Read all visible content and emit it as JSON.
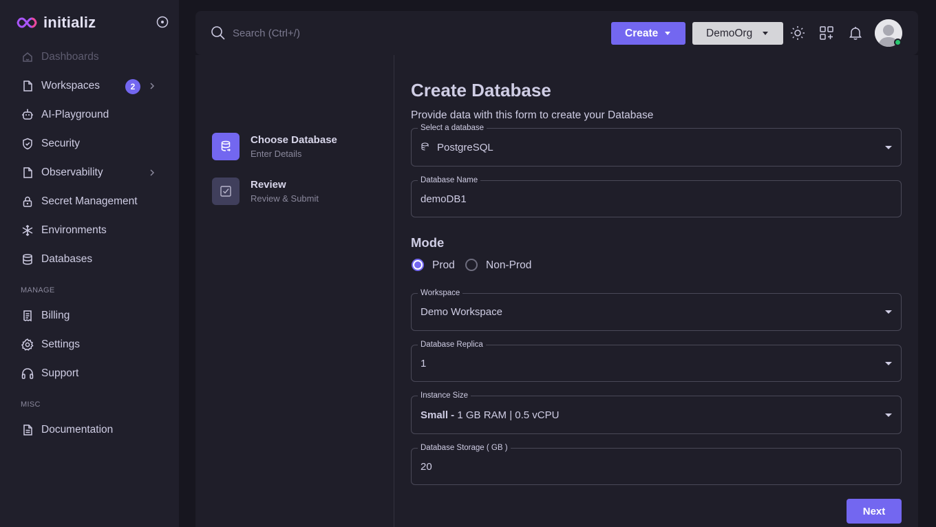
{
  "app": {
    "name": "initializ"
  },
  "sidebar": {
    "items": [
      {
        "label": "Dashboards",
        "icon": "home-icon",
        "disabled": true
      },
      {
        "label": "Workspaces",
        "icon": "file-icon",
        "badge": "2"
      },
      {
        "label": "AI-Playground",
        "icon": "robot-icon"
      },
      {
        "label": "Security",
        "icon": "shield-check-icon"
      },
      {
        "label": "Observability",
        "icon": "file-icon"
      },
      {
        "label": "Secret Management",
        "icon": "lock-icon"
      },
      {
        "label": "Environments",
        "icon": "snowflake-icon"
      },
      {
        "label": "Databases",
        "icon": "database-icon"
      }
    ],
    "manage_title": "MANAGE",
    "manage_items": [
      {
        "label": "Billing",
        "icon": "receipt-icon"
      },
      {
        "label": "Settings",
        "icon": "gear-icon"
      },
      {
        "label": "Support",
        "icon": "headphones-icon"
      }
    ],
    "misc_title": "MISC",
    "misc_items": [
      {
        "label": "Documentation",
        "icon": "document-icon"
      }
    ]
  },
  "topbar": {
    "search_placeholder": "Search (Ctrl+/)",
    "create_label": "Create",
    "org_label": "DemoOrg"
  },
  "steps": [
    {
      "title": "Choose Database",
      "subtitle": "Enter Details",
      "active": true
    },
    {
      "title": "Review",
      "subtitle": "Review & Submit",
      "active": false
    }
  ],
  "form": {
    "title": "Create Database",
    "subtitle": "Provide data with this form to create your Database",
    "database": {
      "label": "Select a database",
      "value": "PostgreSQL"
    },
    "db_name": {
      "label": "Database Name",
      "value": "demoDB1"
    },
    "mode": {
      "title": "Mode",
      "options": [
        "Prod",
        "Non-Prod"
      ],
      "selected": "Prod"
    },
    "workspace": {
      "label": "Workspace",
      "value": "Demo Workspace"
    },
    "replica": {
      "label": "Database Replica",
      "value": "1"
    },
    "instance_size": {
      "label": "Instance Size",
      "value_bold": "Small -",
      "value_rest": "1 GB RAM | 0.5 vCPU"
    },
    "storage": {
      "label": "Database Storage ( GB )",
      "value": "20"
    },
    "next_label": "Next"
  },
  "colors": {
    "accent": "#7367f0",
    "background": "#17161f",
    "surface": "#1f1e29",
    "online": "#28c76f"
  }
}
